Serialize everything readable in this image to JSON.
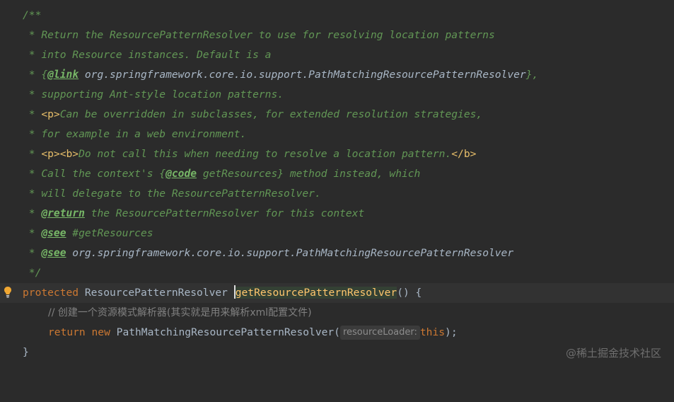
{
  "doc": {
    "open": "/**",
    "l1": " * Return the ResourcePatternResolver to use for resolving location patterns",
    "l2": " * into Resource instances. Default is a",
    "l3_pre": " * {",
    "l3_tag": "@link",
    "l3_ref": " org.springframework.core.io.support.PathMatchingResourcePatternResolver",
    "l3_post": "},",
    "l4": " * supporting Ant-style location patterns.",
    "l5_pre": " * ",
    "l5_tag": "<p>",
    "l5_text": "Can be overridden in subclasses, for extended resolution strategies,",
    "l6": " * for example in a web environment.",
    "l7_pre": " * ",
    "l7_tag1": "<p><b>",
    "l7_text": "Do not call this when needing to resolve a location pattern.",
    "l7_tag2": "</b>",
    "l8_pre": " * Call the context's {",
    "l8_tag": "@code",
    "l8_post": " getResources} method instead, which",
    "l9": " * will delegate to the ResourcePatternResolver.",
    "l10_pre": " * ",
    "l10_tag": "@return",
    "l10_post": " the ResourcePatternResolver for this context",
    "l11_pre": " * ",
    "l11_tag": "@see",
    "l11_post": " #getResources",
    "l12_pre": " * ",
    "l12_tag": "@see",
    "l12_ref": " org.springframework.core.io.support.PathMatchingResourcePatternResolver",
    "close": " */"
  },
  "code": {
    "modifier": "protected",
    "return_type": " ResourcePatternResolver ",
    "method_name": "getResourcePatternResolver",
    "signature_end": "() {",
    "comment": "// 创建一个资源模式解析器(其实就是用来解析xml配置文件)",
    "ret_kw": "return",
    "new_kw": " new",
    "ctor": " PathMatchingResourcePatternResolver(",
    "param_hint": "resourceLoader:",
    "this_kw": "this",
    "stmt_end": ");",
    "close_brace": "}"
  },
  "colors": {
    "background": "#2b2b2b",
    "doc_comment": "#629755",
    "keyword": "#cc7832",
    "method": "#ffc66d"
  },
  "icons": {
    "gutter": "lightbulb-icon"
  },
  "watermark": "@稀土掘金技术社区"
}
